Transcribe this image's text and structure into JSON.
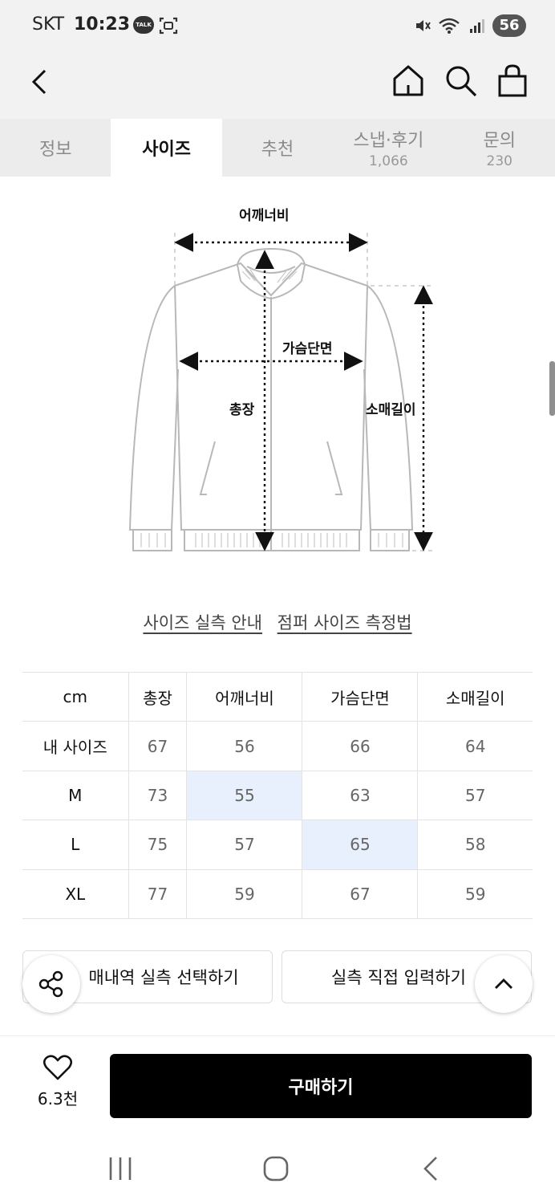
{
  "status_bar": {
    "carrier": "SKT",
    "time": "10:23",
    "talk_badge": "TALK",
    "battery": "56"
  },
  "tabs": [
    {
      "label": "정보",
      "count": ""
    },
    {
      "label": "사이즈",
      "count": ""
    },
    {
      "label": "추천",
      "count": ""
    },
    {
      "label": "스냅·후기",
      "count": "1,066"
    },
    {
      "label": "문의",
      "count": "230"
    }
  ],
  "diagram": {
    "shoulder": "어깨너비",
    "chest": "가슴단면",
    "length": "총장",
    "sleeve": "소매길이"
  },
  "guides": {
    "size_guide": "사이즈 실측 안내",
    "measure_guide": "점퍼 사이즈 측정법"
  },
  "table": {
    "headers": [
      "cm",
      "총장",
      "어깨너비",
      "가슴단면",
      "소매길이"
    ],
    "rows": [
      {
        "label": "내 사이즈",
        "values": [
          "67",
          "56",
          "66",
          "64"
        ]
      },
      {
        "label": "M",
        "values": [
          "73",
          "55",
          "63",
          "57"
        ]
      },
      {
        "label": "L",
        "values": [
          "75",
          "57",
          "65",
          "58"
        ]
      },
      {
        "label": "XL",
        "values": [
          "77",
          "59",
          "67",
          "59"
        ]
      }
    ]
  },
  "actions": {
    "select_history": "매내역 실측 선택하기",
    "direct_input": "실측 직접 입력하기"
  },
  "purchase": {
    "like_count": "6.3천",
    "buy_label": "구매하기"
  },
  "colors": {
    "highlight": "#e8f0fd",
    "buy_button": "#000000"
  }
}
